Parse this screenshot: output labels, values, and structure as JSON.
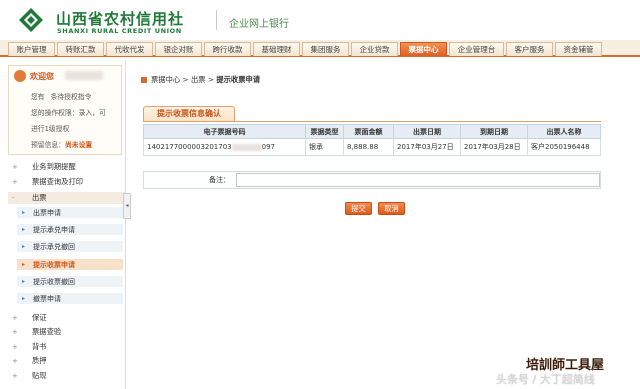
{
  "header": {
    "brand_cn": "山西省农村信用社",
    "brand_en": "SHANXI RURAL CREDIT UNION",
    "bank_title": "企业网上银行",
    "brand_color": "#1f7a3a"
  },
  "nav": {
    "tabs": [
      {
        "label": "账户管理"
      },
      {
        "label": "转账汇款"
      },
      {
        "label": "代收代发"
      },
      {
        "label": "银企对账"
      },
      {
        "label": "跨行收款"
      },
      {
        "label": "基础理财"
      },
      {
        "label": "集团服务"
      },
      {
        "label": "企业贷款"
      },
      {
        "label": "票据中心",
        "active": true
      },
      {
        "label": "企业管理台"
      },
      {
        "label": "客户服务"
      },
      {
        "label": "资金辅管"
      }
    ],
    "accent_color": "#d86a2d"
  },
  "user_panel": {
    "welcome": "欢迎您",
    "line1": "您有",
    "line1_suffix": "条待授权指令",
    "line2": "您的操作权限：录入，可",
    "line3": "进行1级授权",
    "line4_prefix": "预留信息：",
    "settings_link": "尚未设置"
  },
  "sidebar": {
    "menu_top": [
      {
        "label": "业务到期提醒",
        "toggle": "+"
      },
      {
        "label": "票据查询及打印",
        "toggle": "+"
      },
      {
        "label": "出票",
        "toggle": "-"
      }
    ],
    "sub_items": [
      {
        "label": "出票申请"
      },
      {
        "label": "提示承兑申请"
      },
      {
        "label": "提示承兑撤回"
      },
      {
        "label": "提示收票申请",
        "active": true
      },
      {
        "label": "提示收票撤回"
      },
      {
        "label": "撤票申请"
      }
    ],
    "menu_bottom": [
      {
        "label": "保证",
        "toggle": "+"
      },
      {
        "label": "票据查验",
        "toggle": "+"
      },
      {
        "label": "背书",
        "toggle": "+"
      },
      {
        "label": "质押",
        "toggle": "+"
      },
      {
        "label": "贴现",
        "toggle": "+"
      }
    ],
    "collapse_glyph": "◂"
  },
  "main": {
    "breadcrumb": {
      "part1": "票据中心",
      "sep": " > ",
      "part2": "出票",
      "part3": "提示收票申请"
    },
    "section_title": "提示收票信息确认",
    "table": {
      "headers": [
        "电子票据号码",
        "票据类型",
        "票面金额",
        "出票日期",
        "到期日期",
        "出票人名称"
      ],
      "row": {
        "bill_no_prefix": "1402177000003201703",
        "bill_no_suffix": "097",
        "type": "银承",
        "amount": "8,888.88",
        "issue_date": "2017年03月27日",
        "due_date": "2017年03月28日",
        "drawer": "客户2050196448"
      }
    },
    "remark_label": "备注：",
    "remark_value": "",
    "submit_label": "提交",
    "cancel_label": "取消"
  },
  "watermark": {
    "brand": "培訓師工具屋",
    "source": "头条号 / 大丁超简线"
  }
}
